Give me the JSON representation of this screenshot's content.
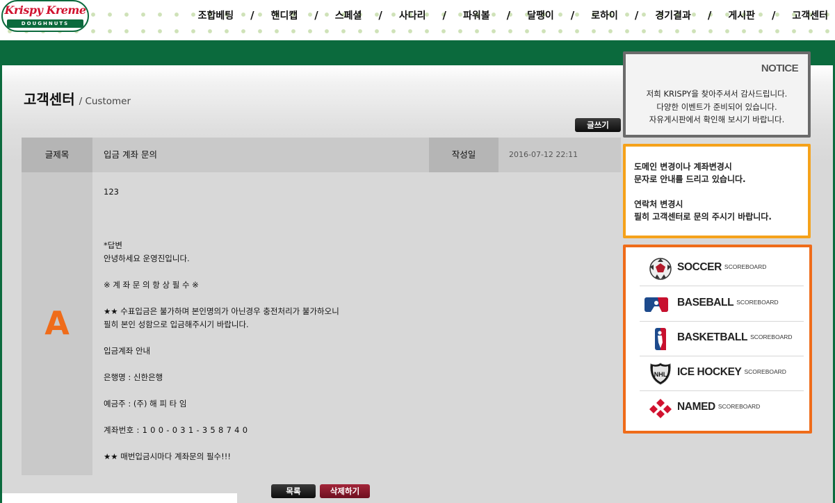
{
  "header": {
    "logo_script": "Krispy Kreme",
    "logo_band": "DOUGHNUTS",
    "nav": [
      {
        "label": "조합베팅"
      },
      {
        "label": "핸디캡"
      },
      {
        "label": "스페셜"
      },
      {
        "label": "사다리"
      },
      {
        "label": "파워볼"
      },
      {
        "label": "달팽이"
      },
      {
        "label": "로하이"
      },
      {
        "label": "경기결과"
      },
      {
        "label": "게시판"
      },
      {
        "label": "고객센터"
      }
    ],
    "nav_separator": "/"
  },
  "page": {
    "title": "고객센터",
    "subtitle": "/ Customer",
    "write_button": "글쓰기"
  },
  "article": {
    "title_label": "글제목",
    "title_value": "입금 계좌 문의",
    "date_label": "작성일",
    "date_value": "2016-07-12 22:11",
    "answer_marker": "A",
    "body_lines": [
      "123",
      "*답변",
      "안녕하세요 운영진입니다.",
      "※ 계 좌 문 의 항 상 필 수 ※",
      "★★ 수표입금은 불가하며 본인명의가 아닌경우 충전처리가 불가하오니",
      "필히 본인 성함으로 입금해주시기 바랍니다.",
      "입금계좌 안내",
      "은행명 :  신한은행",
      "예금주 : (주)  해 피 타 임",
      "계좌번호 :  1 0 0 - 0 3 1  - 3 5 8 7 4 0",
      "★★ 매번입금시마다 계좌문의 필수!!!"
    ],
    "list_button": "목록",
    "delete_button": "삭제하기"
  },
  "sidebar": {
    "notice": {
      "title": "NOTICE",
      "lines": [
        "저희 KRISPY을 찾아주셔서 감사드립니다.",
        "다양한 이벤트가 준비되어 있습니다.",
        "자유게시판에서 확인해 보시기 바랍니다."
      ]
    },
    "info_lines": [
      "도메인 변경이나 계좌변경시",
      "문자로 안내를 드리고 있습니다.",
      "",
      "연락처 변경시",
      "필히 고객센터로 문의 주시기 바랍니다."
    ],
    "scoreboards": [
      {
        "name": "SOCCER",
        "sub": "SCOREBOARD",
        "icon": "soccer-ball-icon"
      },
      {
        "name": "BASEBALL",
        "sub": "SCOREBOARD",
        "icon": "mlb-logo-icon"
      },
      {
        "name": "BASKETBALL",
        "sub": "SCOREBOARD",
        "icon": "nba-logo-icon"
      },
      {
        "name": "ICE HOCKEY",
        "sub": "SCOREBOARD",
        "icon": "nhl-logo-icon"
      },
      {
        "name": "NAMED",
        "sub": "SCOREBOARD",
        "icon": "named-logo-icon"
      }
    ]
  },
  "colors": {
    "brand_green": "#0b6a3d",
    "brand_red": "#d1122f",
    "answer_orange": "#ef6c1a",
    "info_border": "#f5a21b",
    "notice_border": "#6b6b6b"
  }
}
